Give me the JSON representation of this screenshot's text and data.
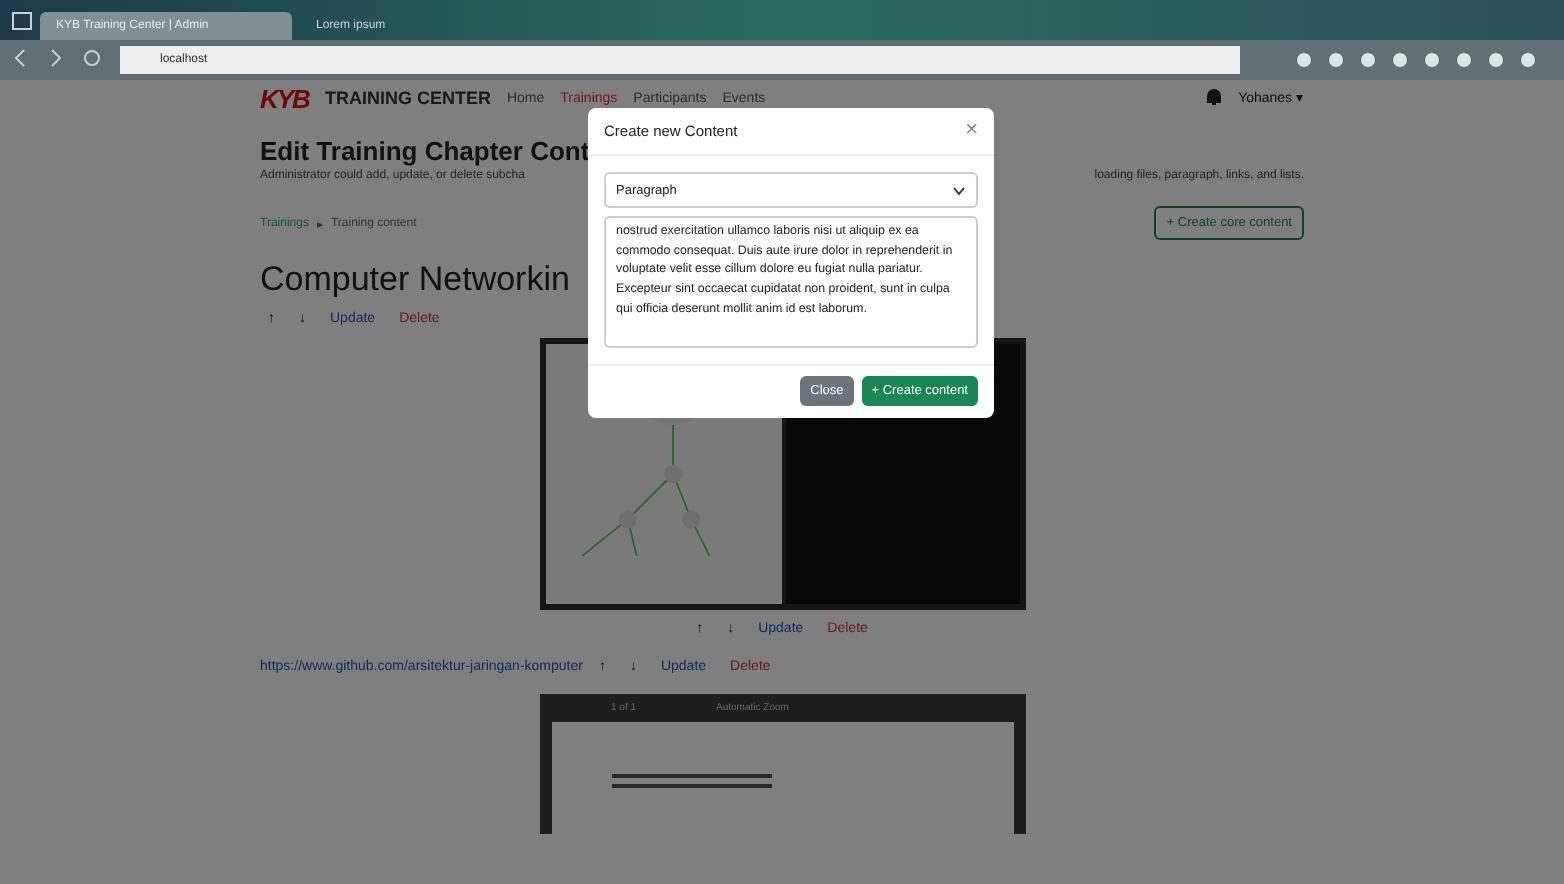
{
  "browser": {
    "tabs": [
      {
        "label": "KYB Training Center | Admin",
        "selected": true
      },
      {
        "label": "Lorem ipsum",
        "selected": false
      }
    ],
    "url": "localhost"
  },
  "navbar": {
    "brand": "TRAINING CENTER",
    "logo": "KYB",
    "links": [
      {
        "label": "Home",
        "selected": false
      },
      {
        "label": "Trainings",
        "selected": true
      },
      {
        "label": "Participants",
        "selected": false
      },
      {
        "label": "Events",
        "selected": false
      }
    ],
    "user": "Yohanes",
    "user_caret": "▾"
  },
  "header": {
    "title": "Edit Training Chapter Cont",
    "description_start": "Administrator could add, update, or delete subcha",
    "description_end": "loading files, paragraph, links, and lists."
  },
  "breadcrumb": [
    "Trainings",
    "▸",
    "Training content"
  ],
  "create_core_button": "+ Create core content",
  "chapter": {
    "title": "Computer Networkin",
    "actions": [
      "↑",
      "↓",
      "Update",
      "Delete"
    ]
  },
  "blocks": [
    {
      "kind": "image",
      "actions": [
        "↑",
        "↓",
        "Update",
        "Delete"
      ]
    },
    {
      "kind": "link",
      "url": "https://www.github.com/arsitektur-jaringan-komputer",
      "actions": [
        "↑",
        "↓",
        "Update",
        "Delete"
      ]
    },
    {
      "kind": "pdf",
      "page": "1 of 1",
      "zoom": "Automatic Zoom"
    }
  ],
  "modal": {
    "title": "Create new Content",
    "close_icon": "×",
    "type_select": "Paragraph",
    "text": "nostrud exercitation ullamco laboris nisi ut aliquip ex ea commodo consequat. Duis aute irure dolor in reprehenderit in voluptate velit esse cillum dolore eu fugiat nulla pariatur. Excepteur sint occaecat cupidatat non proident, sunt in culpa qui officia deserunt mollit anim id est laborum.",
    "buttons": [
      {
        "label": "Close",
        "kind": "secondary"
      },
      {
        "label": "+ Create content",
        "kind": "primary"
      }
    ]
  }
}
